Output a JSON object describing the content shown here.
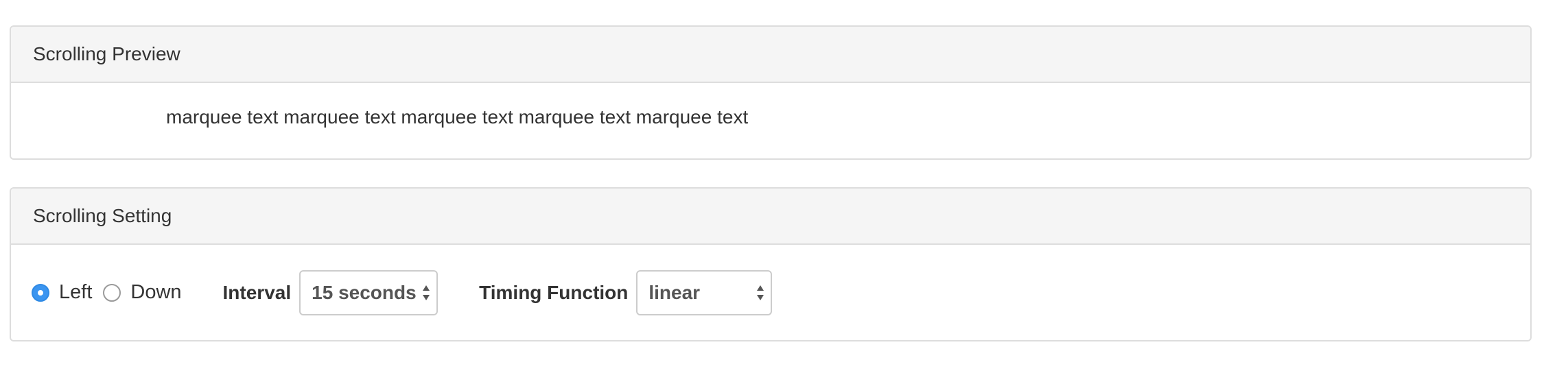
{
  "preview_panel": {
    "heading": "Scrolling Preview",
    "marquee_text": "marquee text marquee text marquee text marquee text marquee text"
  },
  "setting_panel": {
    "heading": "Scrolling Setting",
    "direction": {
      "options": [
        {
          "label": "Left",
          "checked": true
        },
        {
          "label": "Down",
          "checked": false
        }
      ]
    },
    "interval": {
      "label": "Interval",
      "value": "15 seconds"
    },
    "timing_function": {
      "label": "Timing Function",
      "value": "linear"
    }
  },
  "colors": {
    "accent": "#3b95f0",
    "panel_heading_bg": "#f5f5f5",
    "border": "#dddddd"
  }
}
